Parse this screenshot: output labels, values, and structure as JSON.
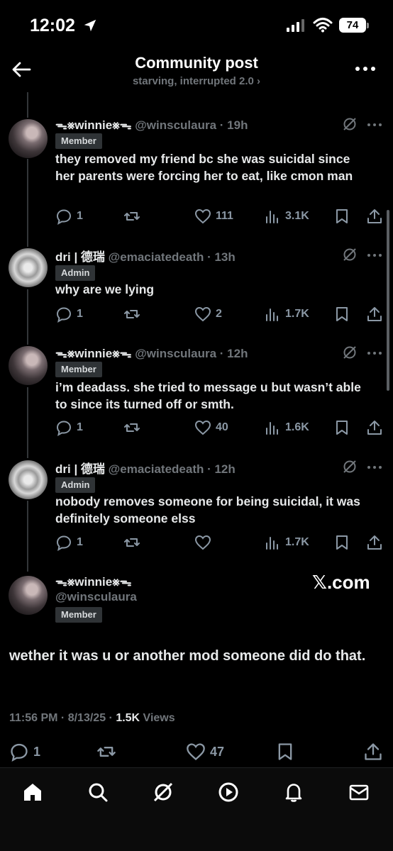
{
  "status_bar": {
    "time": "12:02",
    "battery": "74"
  },
  "header": {
    "title": "Community post",
    "subtitle": "starving, interrupted 2.0 ›"
  },
  "replies": [
    {
      "name": "ᯓ⨳winnie⨳ᯓ",
      "handle": "@winsculaura · 19h",
      "badge": "Member",
      "text": "they removed my friend bc she was suicidal since her parents were forcing her to eat, like cmon man",
      "replies": "1",
      "reposts": "",
      "likes": "111",
      "views": "3.1K"
    },
    {
      "name": "dri | 德瑞",
      "handle": "@emaciatedeath · 13h",
      "badge": "Admin",
      "text": "why are we lying",
      "replies": "1",
      "reposts": "",
      "likes": "2",
      "views": "1.7K"
    },
    {
      "name": "ᯓ⨳winnie⨳ᯓ",
      "handle": "@winsculaura · 12h",
      "badge": "Member",
      "text": "i’m deadass. she tried to message u but wasn’t able to since its turned off or smth.",
      "replies": "1",
      "reposts": "",
      "likes": "40",
      "views": "1.6K"
    },
    {
      "name": "dri | 德瑞",
      "handle": "@emaciatedeath · 12h",
      "badge": "Admin",
      "text": "nobody removes someone for being suicidal, it was definitely someone elss",
      "replies": "1",
      "reposts": "",
      "likes": "",
      "views": "1.7K"
    }
  ],
  "main_post": {
    "name": "ᯓ⨳winnie⨳ᯓ",
    "handle": "@winsculaura",
    "badge": "Member",
    "watermark": "𝕏.com",
    "text": "wether it was u or another mod someone did do that.",
    "time": "11:56 PM · 8/13/25 · ",
    "views_count": "1.5K",
    "views_label": " Views",
    "replies": "1",
    "likes": "47"
  },
  "nav": [
    "home-icon",
    "search-icon",
    "grok-icon",
    "video-icon",
    "notifications-icon",
    "messages-icon"
  ]
}
